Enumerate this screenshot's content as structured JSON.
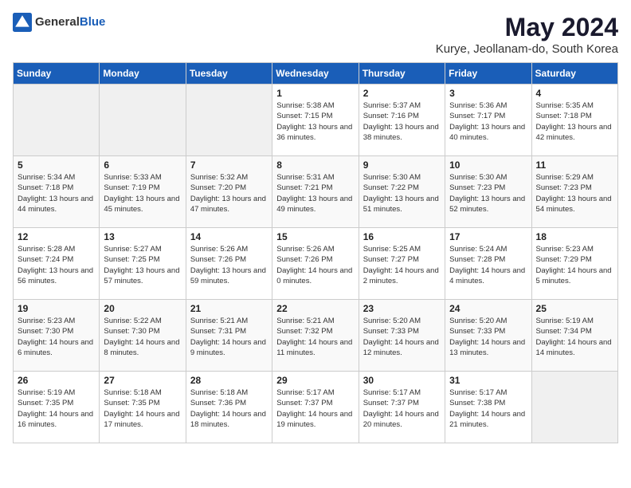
{
  "logo": {
    "general": "General",
    "blue": "Blue"
  },
  "title": "May 2024",
  "subtitle": "Kurye, Jeollanam-do, South Korea",
  "days_header": [
    "Sunday",
    "Monday",
    "Tuesday",
    "Wednesday",
    "Thursday",
    "Friday",
    "Saturday"
  ],
  "weeks": [
    [
      {
        "day": "",
        "sunrise": "",
        "sunset": "",
        "daylight": ""
      },
      {
        "day": "",
        "sunrise": "",
        "sunset": "",
        "daylight": ""
      },
      {
        "day": "",
        "sunrise": "",
        "sunset": "",
        "daylight": ""
      },
      {
        "day": "1",
        "sunrise": "Sunrise: 5:38 AM",
        "sunset": "Sunset: 7:15 PM",
        "daylight": "Daylight: 13 hours and 36 minutes."
      },
      {
        "day": "2",
        "sunrise": "Sunrise: 5:37 AM",
        "sunset": "Sunset: 7:16 PM",
        "daylight": "Daylight: 13 hours and 38 minutes."
      },
      {
        "day": "3",
        "sunrise": "Sunrise: 5:36 AM",
        "sunset": "Sunset: 7:17 PM",
        "daylight": "Daylight: 13 hours and 40 minutes."
      },
      {
        "day": "4",
        "sunrise": "Sunrise: 5:35 AM",
        "sunset": "Sunset: 7:18 PM",
        "daylight": "Daylight: 13 hours and 42 minutes."
      }
    ],
    [
      {
        "day": "5",
        "sunrise": "Sunrise: 5:34 AM",
        "sunset": "Sunset: 7:18 PM",
        "daylight": "Daylight: 13 hours and 44 minutes."
      },
      {
        "day": "6",
        "sunrise": "Sunrise: 5:33 AM",
        "sunset": "Sunset: 7:19 PM",
        "daylight": "Daylight: 13 hours and 45 minutes."
      },
      {
        "day": "7",
        "sunrise": "Sunrise: 5:32 AM",
        "sunset": "Sunset: 7:20 PM",
        "daylight": "Daylight: 13 hours and 47 minutes."
      },
      {
        "day": "8",
        "sunrise": "Sunrise: 5:31 AM",
        "sunset": "Sunset: 7:21 PM",
        "daylight": "Daylight: 13 hours and 49 minutes."
      },
      {
        "day": "9",
        "sunrise": "Sunrise: 5:30 AM",
        "sunset": "Sunset: 7:22 PM",
        "daylight": "Daylight: 13 hours and 51 minutes."
      },
      {
        "day": "10",
        "sunrise": "Sunrise: 5:30 AM",
        "sunset": "Sunset: 7:23 PM",
        "daylight": "Daylight: 13 hours and 52 minutes."
      },
      {
        "day": "11",
        "sunrise": "Sunrise: 5:29 AM",
        "sunset": "Sunset: 7:23 PM",
        "daylight": "Daylight: 13 hours and 54 minutes."
      }
    ],
    [
      {
        "day": "12",
        "sunrise": "Sunrise: 5:28 AM",
        "sunset": "Sunset: 7:24 PM",
        "daylight": "Daylight: 13 hours and 56 minutes."
      },
      {
        "day": "13",
        "sunrise": "Sunrise: 5:27 AM",
        "sunset": "Sunset: 7:25 PM",
        "daylight": "Daylight: 13 hours and 57 minutes."
      },
      {
        "day": "14",
        "sunrise": "Sunrise: 5:26 AM",
        "sunset": "Sunset: 7:26 PM",
        "daylight": "Daylight: 13 hours and 59 minutes."
      },
      {
        "day": "15",
        "sunrise": "Sunrise: 5:26 AM",
        "sunset": "Sunset: 7:26 PM",
        "daylight": "Daylight: 14 hours and 0 minutes."
      },
      {
        "day": "16",
        "sunrise": "Sunrise: 5:25 AM",
        "sunset": "Sunset: 7:27 PM",
        "daylight": "Daylight: 14 hours and 2 minutes."
      },
      {
        "day": "17",
        "sunrise": "Sunrise: 5:24 AM",
        "sunset": "Sunset: 7:28 PM",
        "daylight": "Daylight: 14 hours and 4 minutes."
      },
      {
        "day": "18",
        "sunrise": "Sunrise: 5:23 AM",
        "sunset": "Sunset: 7:29 PM",
        "daylight": "Daylight: 14 hours and 5 minutes."
      }
    ],
    [
      {
        "day": "19",
        "sunrise": "Sunrise: 5:23 AM",
        "sunset": "Sunset: 7:30 PM",
        "daylight": "Daylight: 14 hours and 6 minutes."
      },
      {
        "day": "20",
        "sunrise": "Sunrise: 5:22 AM",
        "sunset": "Sunset: 7:30 PM",
        "daylight": "Daylight: 14 hours and 8 minutes."
      },
      {
        "day": "21",
        "sunrise": "Sunrise: 5:21 AM",
        "sunset": "Sunset: 7:31 PM",
        "daylight": "Daylight: 14 hours and 9 minutes."
      },
      {
        "day": "22",
        "sunrise": "Sunrise: 5:21 AM",
        "sunset": "Sunset: 7:32 PM",
        "daylight": "Daylight: 14 hours and 11 minutes."
      },
      {
        "day": "23",
        "sunrise": "Sunrise: 5:20 AM",
        "sunset": "Sunset: 7:33 PM",
        "daylight": "Daylight: 14 hours and 12 minutes."
      },
      {
        "day": "24",
        "sunrise": "Sunrise: 5:20 AM",
        "sunset": "Sunset: 7:33 PM",
        "daylight": "Daylight: 14 hours and 13 minutes."
      },
      {
        "day": "25",
        "sunrise": "Sunrise: 5:19 AM",
        "sunset": "Sunset: 7:34 PM",
        "daylight": "Daylight: 14 hours and 14 minutes."
      }
    ],
    [
      {
        "day": "26",
        "sunrise": "Sunrise: 5:19 AM",
        "sunset": "Sunset: 7:35 PM",
        "daylight": "Daylight: 14 hours and 16 minutes."
      },
      {
        "day": "27",
        "sunrise": "Sunrise: 5:18 AM",
        "sunset": "Sunset: 7:35 PM",
        "daylight": "Daylight: 14 hours and 17 minutes."
      },
      {
        "day": "28",
        "sunrise": "Sunrise: 5:18 AM",
        "sunset": "Sunset: 7:36 PM",
        "daylight": "Daylight: 14 hours and 18 minutes."
      },
      {
        "day": "29",
        "sunrise": "Sunrise: 5:17 AM",
        "sunset": "Sunset: 7:37 PM",
        "daylight": "Daylight: 14 hours and 19 minutes."
      },
      {
        "day": "30",
        "sunrise": "Sunrise: 5:17 AM",
        "sunset": "Sunset: 7:37 PM",
        "daylight": "Daylight: 14 hours and 20 minutes."
      },
      {
        "day": "31",
        "sunrise": "Sunrise: 5:17 AM",
        "sunset": "Sunset: 7:38 PM",
        "daylight": "Daylight: 14 hours and 21 minutes."
      },
      {
        "day": "",
        "sunrise": "",
        "sunset": "",
        "daylight": ""
      }
    ]
  ]
}
